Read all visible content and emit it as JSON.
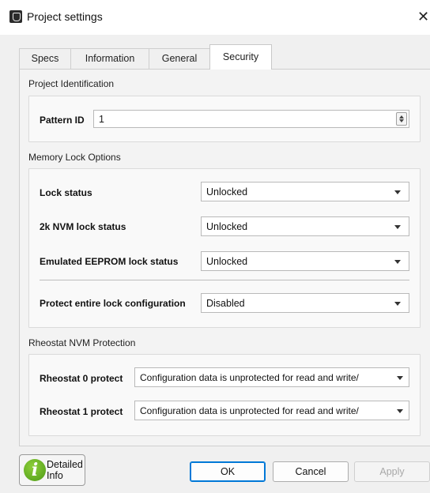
{
  "window": {
    "title": "Project settings",
    "close_glyph": "✕",
    "icon": "app-icon"
  },
  "tabs": [
    {
      "label": "Specs",
      "active": false
    },
    {
      "label": "Information",
      "active": false
    },
    {
      "label": "General",
      "active": false
    },
    {
      "label": "Security",
      "active": true
    }
  ],
  "project_identification": {
    "section_label": "Project Identification",
    "pattern_id_label": "Pattern ID",
    "pattern_id_value": "1"
  },
  "memory_lock": {
    "section_label": "Memory Lock Options",
    "lock_status": {
      "label": "Lock status",
      "value": "Unlocked"
    },
    "nvm_2k_lock_status": {
      "label": "2k NVM lock status",
      "value": "Unlocked"
    },
    "eeprom_lock_status": {
      "label": "Emulated EEPROM lock status",
      "value": "Unlocked"
    },
    "protect_config": {
      "label": "Protect entire lock configuration",
      "value": "Disabled"
    }
  },
  "rheostat": {
    "section_label": "Rheostat NVM Protection",
    "rheostat0": {
      "label": "Rheostat 0 protect",
      "value": "Configuration data is unprotected for read and write/"
    },
    "rheostat1": {
      "label": "Rheostat 1 protect",
      "value": "Configuration data is unprotected for read and write/"
    }
  },
  "buttons": {
    "detailed_info": "Detailed Info",
    "ok": "OK",
    "cancel": "Cancel",
    "apply": "Apply"
  },
  "colors": {
    "default_button_border": "#0078d7",
    "info_icon_green": "#5aa81e"
  }
}
